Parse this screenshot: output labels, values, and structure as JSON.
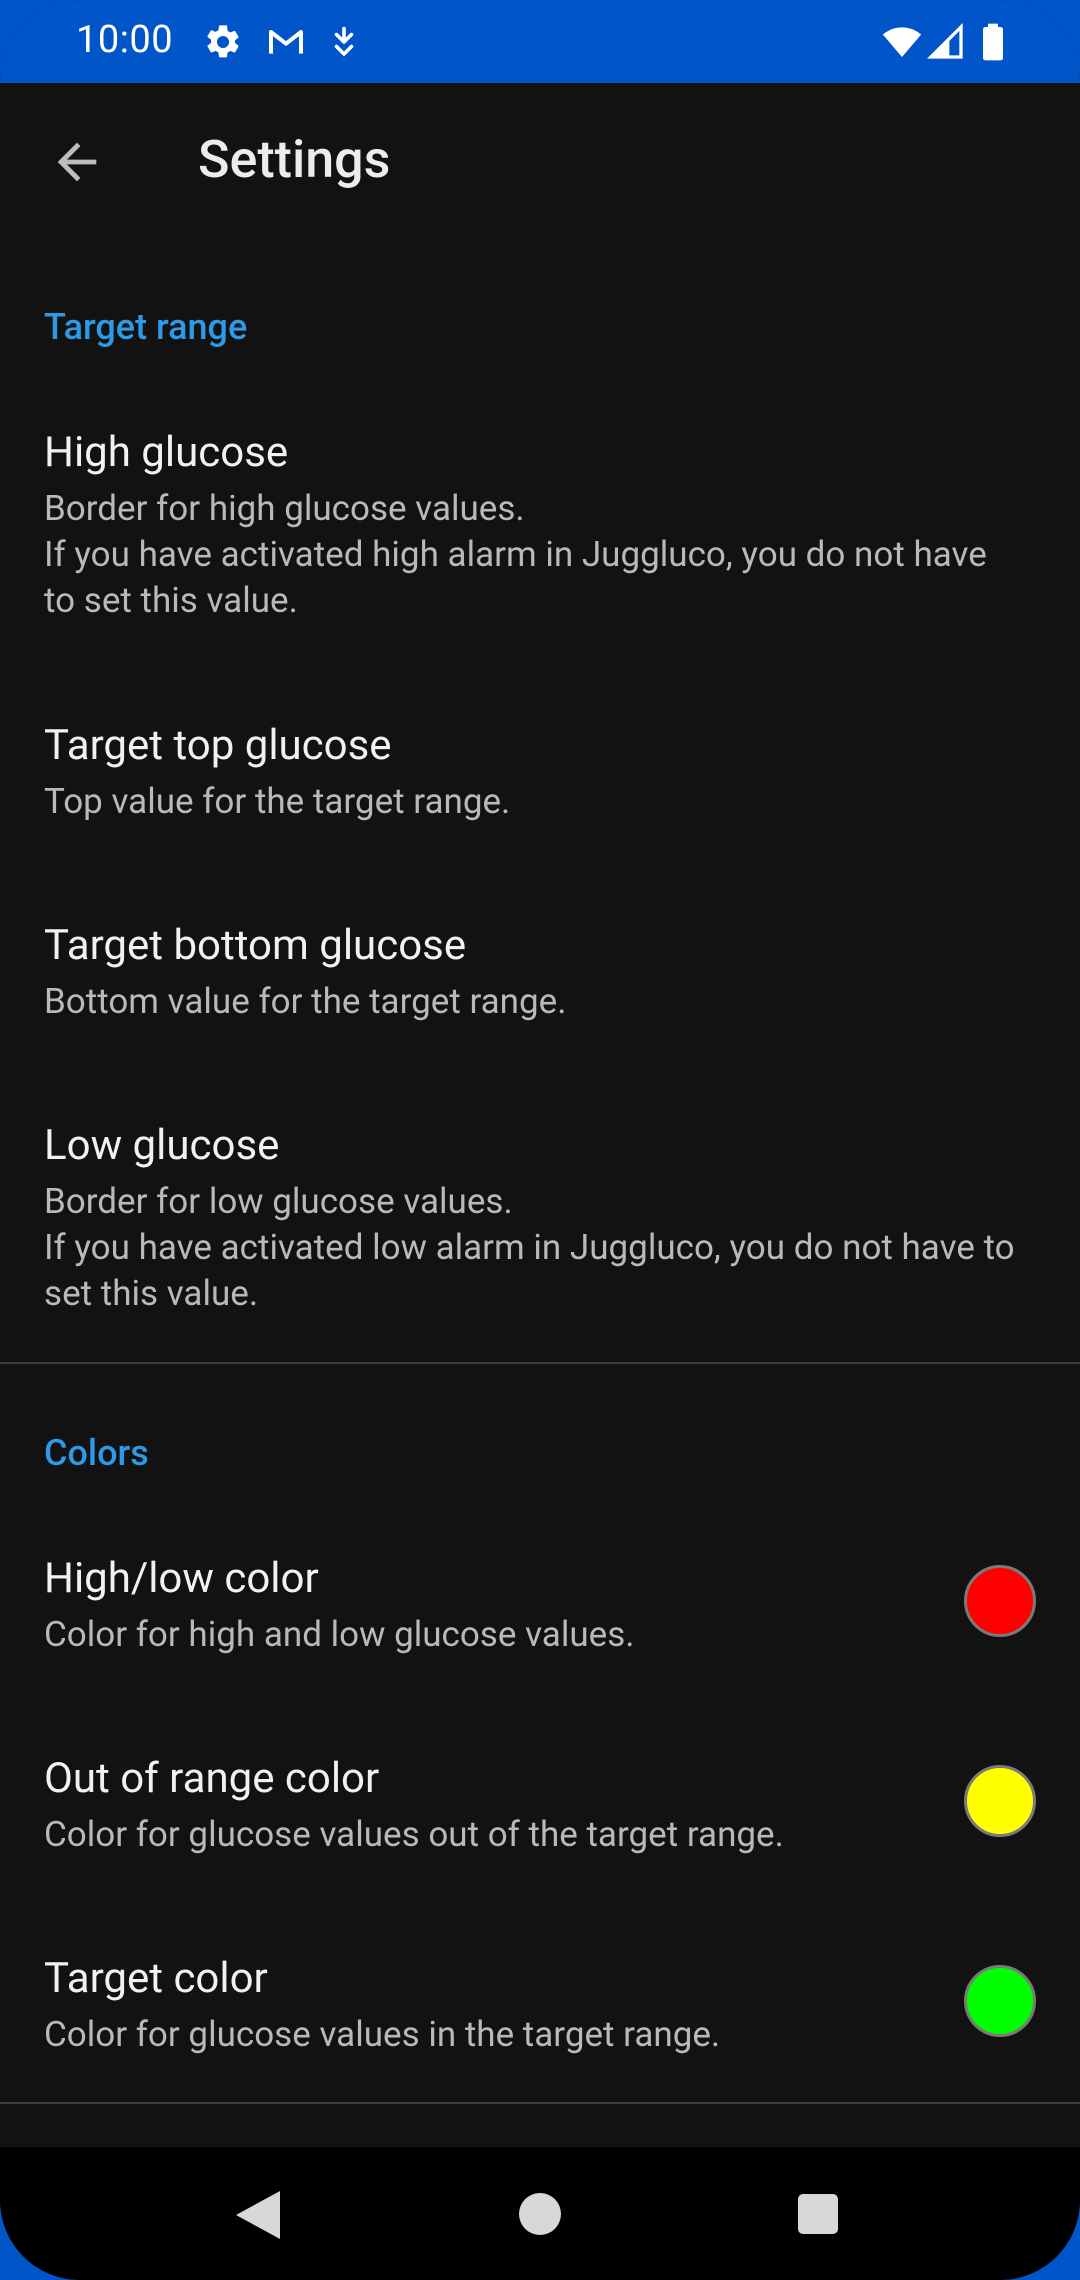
{
  "status_bar": {
    "time": "10:00",
    "left_icons": [
      "settings-icon",
      "gmail-icon",
      "download-icon"
    ],
    "right_icons": [
      "wifi-icon",
      "cell-signal-icon",
      "battery-icon"
    ],
    "background_color": "#0055c9"
  },
  "app_bar": {
    "title": "Settings",
    "back_icon": "arrow-back-icon"
  },
  "sections": [
    {
      "header": "Target range",
      "items": [
        {
          "title": "High glucose",
          "summary": "Border for high glucose values.\nIf you have activated high alarm in Juggluco, you do not have to set this value."
        },
        {
          "title": "Target top glucose",
          "summary": "Top value for the target range."
        },
        {
          "title": "Target bottom glucose",
          "summary": "Bottom value for the target range."
        },
        {
          "title": "Low glucose",
          "summary": "Border for low glucose values.\nIf you have activated low alarm in Juggluco, you do not have to set this value."
        }
      ]
    },
    {
      "header": "Colors",
      "items": [
        {
          "title": "High/low color",
          "summary": "Color for high and low glucose values.",
          "color": "#ff0000"
        },
        {
          "title": "Out of range color",
          "summary": "Color for glucose values out of the target range.",
          "color": "#ffff00"
        },
        {
          "title": "Target color",
          "summary": "Color for glucose values in the target range.",
          "color": "#00ff00"
        }
      ]
    }
  ],
  "theme": {
    "accent": "#2d9ae8",
    "background": "#121212"
  },
  "nav_bar": {
    "icons": [
      "nav-back-icon",
      "nav-home-icon",
      "nav-recents-icon"
    ]
  }
}
